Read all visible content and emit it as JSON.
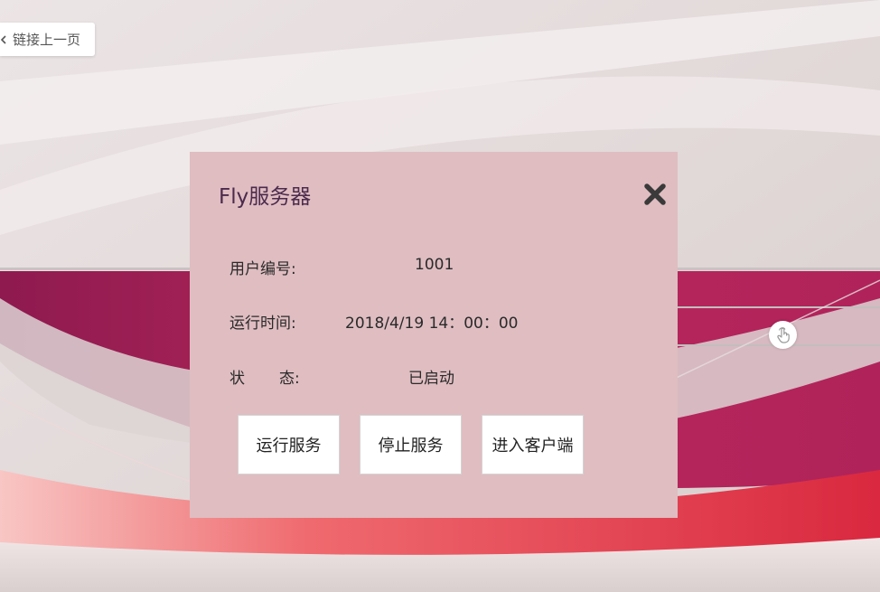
{
  "nav": {
    "back_label": "链接上一页",
    "back_icon": "chevron-left-icon"
  },
  "dialog": {
    "title": "Fly服务器",
    "close_icon": "close-icon",
    "fields": {
      "user_id_label": "用户编号:",
      "user_id_value": "1001",
      "run_time_label": "运行时间:",
      "run_time_value": "2018/4/19 14：00：00",
      "status_label_1": "状",
      "status_label_2": "态:",
      "status_value": "已启动"
    },
    "buttons": {
      "run": "运行服务",
      "stop": "停止服务",
      "enter_client": "进入客户端"
    }
  },
  "floating": {
    "touch_icon": "touch-hand-icon"
  },
  "colors": {
    "panel_bg": "#dfbdc1",
    "title": "#4b2a4d",
    "accent_magenta": "#a01d58",
    "accent_red": "#e9505e"
  }
}
